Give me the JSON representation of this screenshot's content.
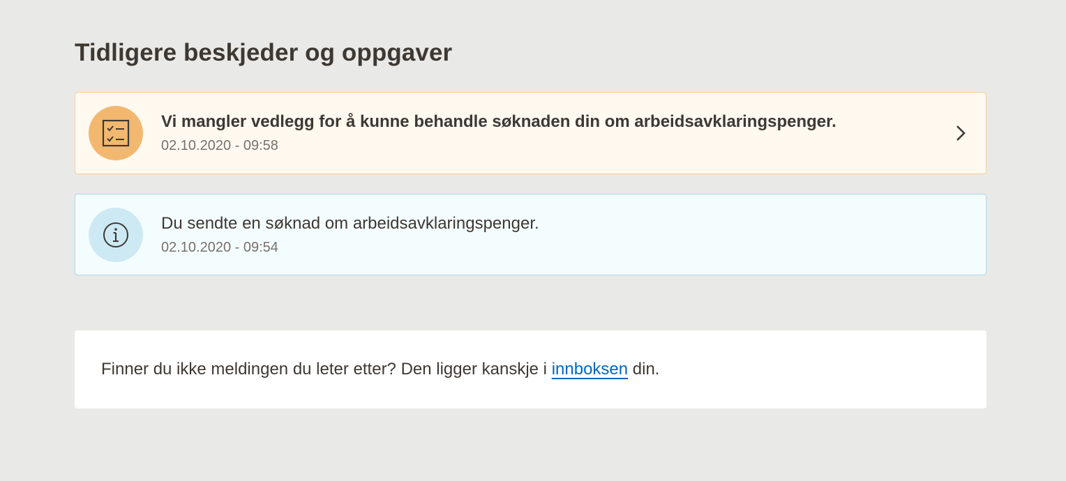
{
  "section": {
    "title": "Tidligere beskjeder og oppgaver"
  },
  "notifications": [
    {
      "type": "task",
      "icon": "checklist-icon",
      "message": "Vi mangler vedlegg for å kunne behandle søknaden din om arbeidsavklaringspenger.",
      "date": "02.10.2020 - 09:58",
      "accent_color": "#f2b870",
      "background_color": "#fff9f0"
    },
    {
      "type": "info",
      "icon": "info-icon",
      "message": "Du sendte en søknad om arbeidsavklaringspenger.",
      "date": "02.10.2020 - 09:54",
      "accent_color": "#cde9f4",
      "background_color": "#f4fdfe"
    }
  ],
  "inbox_hint": {
    "text_before": "Finner du ikke meldingen du leter etter? Den ligger kanskje i ",
    "link_text": "innboksen",
    "text_after": " din.",
    "link_color": "#0067c5"
  }
}
